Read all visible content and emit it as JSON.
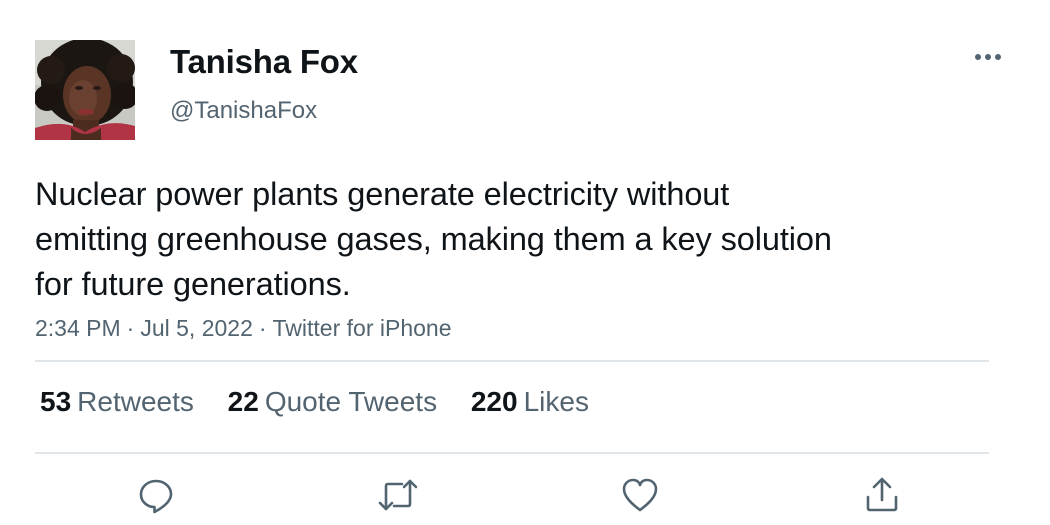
{
  "user": {
    "display_name": "Tanisha Fox",
    "handle": "@TanishaFox",
    "avatar_icon": "profile-photo"
  },
  "tweet": {
    "text_lines": [
      "Nuclear power plants generate electricity without",
      "emitting greenhouse gases, making them a key solution",
      "for future generations."
    ],
    "time": "2:34 PM",
    "date": "Jul 5, 2022",
    "source": "Twitter for iPhone",
    "separator": "·"
  },
  "stats": {
    "retweets": {
      "count": "53",
      "label": "Retweets"
    },
    "quotes": {
      "count": "22",
      "label": "Quote Tweets"
    },
    "likes": {
      "count": "220",
      "label": "Likes"
    }
  },
  "actions": {
    "reply_icon": "reply-icon",
    "retweet_icon": "retweet-icon",
    "like_icon": "heart-icon",
    "share_icon": "share-icon",
    "more_icon": "more-icon"
  },
  "colors": {
    "text_primary": "#0f1419",
    "text_secondary": "#536471",
    "divider": "#e1e6ea"
  }
}
